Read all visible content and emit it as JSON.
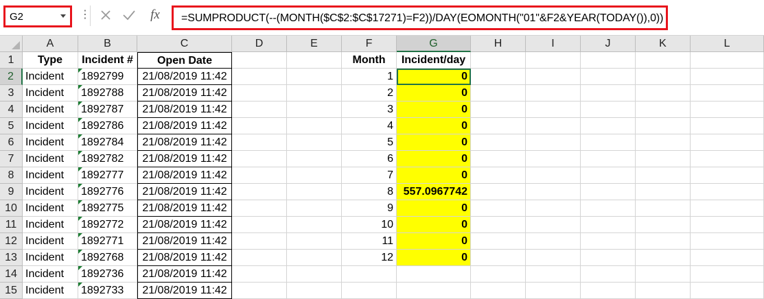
{
  "formula_bar": {
    "name_box": "G2",
    "dots": "⋮",
    "cancel_glyph": "✕",
    "enter_glyph": "✓",
    "fx_label": "fx",
    "formula": "=SUMPRODUCT(--(MONTH($C$2:$C$17271)=F2))/DAY(EOMONTH(\"01\"&F2&YEAR(TODAY()),0))"
  },
  "colors": {
    "highlight_border": "#e8141c",
    "selection": "#217346",
    "fill_yellow": "#ffff00"
  },
  "grid": {
    "selected_cell": "G2",
    "columns": [
      "A",
      "B",
      "C",
      "D",
      "E",
      "F",
      "G",
      "H",
      "I",
      "J",
      "K",
      "L"
    ],
    "rows": [
      "1",
      "2",
      "3",
      "4",
      "5",
      "6",
      "7",
      "8",
      "9",
      "10",
      "11",
      "12",
      "13",
      "14",
      "15"
    ],
    "headers": {
      "A": "Type",
      "B": "Incident #",
      "C": "Open Date",
      "F": "Month",
      "G": "Incident/day"
    },
    "type_col": [
      "Incident",
      "Incident",
      "Incident",
      "Incident",
      "Incident",
      "Incident",
      "Incident",
      "Incident",
      "Incident",
      "Incident",
      "Incident",
      "Incident",
      "Incident",
      "Incident"
    ],
    "incident_col": [
      "1892799",
      "1892788",
      "1892787",
      "1892786",
      "1892784",
      "1892782",
      "1892777",
      "1892776",
      "1892775",
      "1892772",
      "1892771",
      "1892768",
      "1892736",
      "1892733"
    ],
    "date_col": [
      "21/08/2019 11:42",
      "21/08/2019 11:42",
      "21/08/2019 11:42",
      "21/08/2019 11:42",
      "21/08/2019 11:42",
      "21/08/2019 11:42",
      "21/08/2019 11:42",
      "21/08/2019 11:42",
      "21/08/2019 11:42",
      "21/08/2019 11:42",
      "21/08/2019 11:42",
      "21/08/2019 11:42",
      "21/08/2019 11:42",
      "21/08/2019 11:42"
    ],
    "month_col": [
      "1",
      "2",
      "3",
      "4",
      "5",
      "6",
      "7",
      "8",
      "9",
      "10",
      "11",
      "12"
    ],
    "per_day_col": [
      "0",
      "0",
      "0",
      "0",
      "0",
      "0",
      "0",
      "557.0967742",
      "0",
      "0",
      "0",
      "0"
    ]
  }
}
